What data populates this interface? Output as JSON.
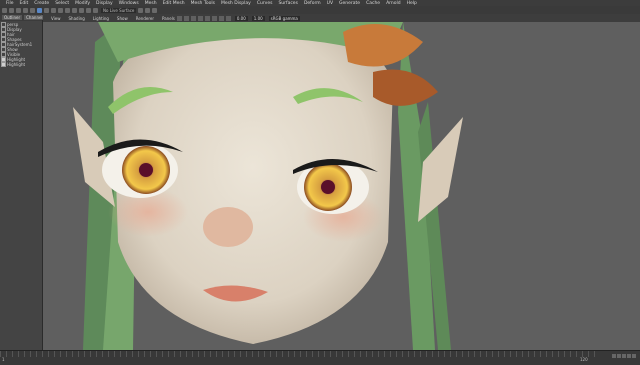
{
  "menu": [
    "File",
    "Edit",
    "Create",
    "Select",
    "Modify",
    "Display",
    "Windows",
    "Mesh",
    "Edit Mesh",
    "Mesh Tools",
    "Mesh Display",
    "Curves",
    "Surfaces",
    "Deform",
    "UV",
    "Generate",
    "Cache",
    "Arnold",
    "Help"
  ],
  "toolbar": {
    "camera_field": "No Live Surface",
    "workspace": "sRGB gamma"
  },
  "left_panel": {
    "tabs": [
      "Outliner",
      "Channel Box"
    ],
    "rows": [
      {
        "label": "persp",
        "checked": false
      },
      {
        "label": "Display",
        "checked": false
      },
      {
        "label": "hair",
        "checked": false
      },
      {
        "label": "Shapes",
        "checked": false
      },
      {
        "label": "hairSystem1",
        "checked": false
      },
      {
        "label": "Show",
        "checked": false
      },
      {
        "label": "Visible",
        "checked": false
      },
      {
        "label": "Highlight",
        "checked": true
      },
      {
        "label": "Highlight",
        "checked": true
      }
    ]
  },
  "viewport_menu": [
    "View",
    "Shading",
    "Lighting",
    "Show",
    "Renderer",
    "Panels"
  ],
  "viewport_values": {
    "near": "0.00",
    "far": "1.00"
  },
  "timeline": {
    "start": "1",
    "end": "120"
  }
}
